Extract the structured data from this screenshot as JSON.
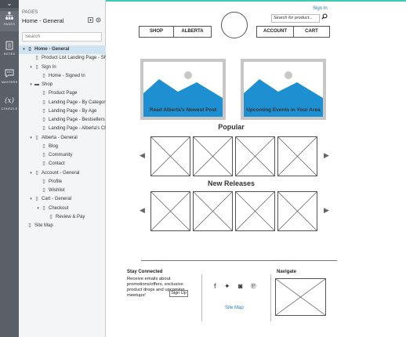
{
  "rail": {
    "chevron": "⌄",
    "items": [
      {
        "label": "PAGES",
        "icon": "sitemap-icon"
      },
      {
        "label": "NOTES",
        "icon": "notes-icon"
      },
      {
        "label": "MASTERS",
        "icon": "masters-icon"
      },
      {
        "label": "CONSOLE",
        "icon": "console-icon",
        "glyph": "(x)"
      }
    ]
  },
  "panel": {
    "title": "PAGES",
    "subtitle": "Home - General",
    "search_placeholder": "Search",
    "tree": [
      {
        "label": "Home - General",
        "level": 0,
        "caret": "▾",
        "selected": true,
        "type": "page"
      },
      {
        "label": "Product List Landing Page - Shop",
        "level": 1,
        "caret": "",
        "type": "page"
      },
      {
        "label": "Sign In",
        "level": 1,
        "caret": "▾",
        "type": "page"
      },
      {
        "label": "Home - Signed In",
        "level": 2,
        "caret": "",
        "type": "page"
      },
      {
        "label": "Shop",
        "level": 1,
        "caret": "▾",
        "type": "folder"
      },
      {
        "label": "Product Page",
        "level": 2,
        "caret": "",
        "type": "page"
      },
      {
        "label": "Landing Page - By Category",
        "level": 2,
        "caret": "",
        "type": "page"
      },
      {
        "label": "Landing Page - By Age",
        "level": 2,
        "caret": "",
        "type": "page"
      },
      {
        "label": "Landing Page - Bestsellers",
        "level": 2,
        "caret": "",
        "type": "page"
      },
      {
        "label": "Landing Page - Alberta's Choice",
        "level": 2,
        "caret": "",
        "type": "page"
      },
      {
        "label": "Alberta - General",
        "level": 1,
        "caret": "▾",
        "type": "page"
      },
      {
        "label": "Blog",
        "level": 2,
        "caret": "",
        "type": "page"
      },
      {
        "label": "Community",
        "level": 2,
        "caret": "",
        "type": "page"
      },
      {
        "label": "Contact",
        "level": 2,
        "caret": "",
        "type": "page"
      },
      {
        "label": "Account - General",
        "level": 1,
        "caret": "▾",
        "type": "page"
      },
      {
        "label": "Profile",
        "level": 2,
        "caret": "",
        "type": "page"
      },
      {
        "label": "Wishlist",
        "level": 2,
        "caret": "",
        "type": "page"
      },
      {
        "label": "Cart - General",
        "level": 1,
        "caret": "▾",
        "type": "page"
      },
      {
        "label": "Checkout",
        "level": 2,
        "caret": "▾",
        "type": "page"
      },
      {
        "label": "Review & Pay",
        "level": 3,
        "caret": "",
        "type": "page"
      },
      {
        "label": "Site Map",
        "level": 0,
        "caret": "",
        "type": "page"
      }
    ]
  },
  "canvas": {
    "signin": "Sign In",
    "search_placeholder": "Search for product...",
    "nav_left": [
      "SHOP",
      "ALBERTA"
    ],
    "nav_right": [
      "ACCOUNT",
      "CART"
    ],
    "heroes": [
      {
        "caption": "Read Alberta's Newest Post"
      },
      {
        "caption": "Upcoming Events in Your Area"
      }
    ],
    "popular_title": "Popular",
    "releases_title": "New Releases",
    "footer": {
      "stay_title": "Stay Connected",
      "stay_text": "Receive emails about promotions/offers, exclusive product drops and upcoming meetups!",
      "signup_label": "Sign Up",
      "social_icons": [
        "facebook-icon",
        "twitter-icon",
        "instagram-icon",
        "pinterest-icon"
      ],
      "social_glyphs": "f ✦ ◙ ℗",
      "sitemap_link": "Site Map",
      "navigate_title": "Navigate"
    }
  },
  "colors": {
    "accent_teal": "#3ec9b7",
    "link_blue": "#2a7bc0",
    "image_blue": "#1e8fd0",
    "selection": "#cfe3f3"
  }
}
